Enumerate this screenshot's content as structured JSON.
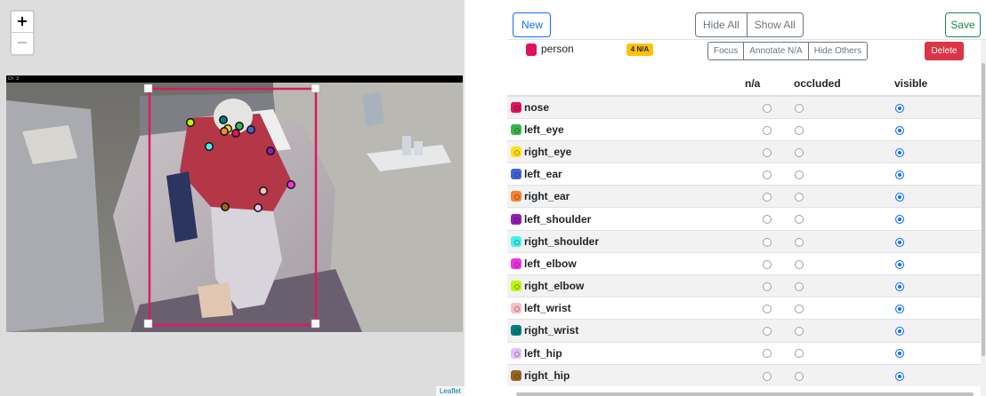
{
  "map": {
    "zoom_in": "+",
    "zoom_out": "−",
    "channel_label": "Ch 3",
    "attribution": "Leaflet",
    "bbox_color": "#d81b60"
  },
  "toolbar": {
    "new_label": "New",
    "hide_all_label": "Hide All",
    "show_all_label": "Show All",
    "save_label": "Save"
  },
  "object": {
    "name": "person",
    "color": "#e0115f",
    "na_badge": "4 N/A",
    "focus_label": "Focus",
    "annotate_na_label": "Annotate N/A",
    "hide_others_label": "Hide Others",
    "delete_label": "Delete"
  },
  "table": {
    "headers": [
      "",
      "n/a",
      "occluded",
      "visible"
    ],
    "keypoints": [
      {
        "name": "nose",
        "color": "#e0115f",
        "state": "visible"
      },
      {
        "name": "left_eye",
        "color": "#3cb44b",
        "state": "visible"
      },
      {
        "name": "right_eye",
        "color": "#ffe119",
        "state": "visible"
      },
      {
        "name": "left_ear",
        "color": "#4363d8",
        "state": "visible"
      },
      {
        "name": "right_ear",
        "color": "#f58231",
        "state": "visible"
      },
      {
        "name": "left_shoulder",
        "color": "#911eb4",
        "state": "visible"
      },
      {
        "name": "right_shoulder",
        "color": "#46f0f0",
        "state": "visible"
      },
      {
        "name": "left_elbow",
        "color": "#f032e6",
        "state": "visible"
      },
      {
        "name": "right_elbow",
        "color": "#bcf60c",
        "state": "visible"
      },
      {
        "name": "left_wrist",
        "color": "#fabebe",
        "state": "visible"
      },
      {
        "name": "right_wrist",
        "color": "#008080",
        "state": "visible"
      },
      {
        "name": "left_hip",
        "color": "#e6beff",
        "state": "visible"
      },
      {
        "name": "right_hip",
        "color": "#9a6324",
        "state": "visible"
      }
    ]
  }
}
